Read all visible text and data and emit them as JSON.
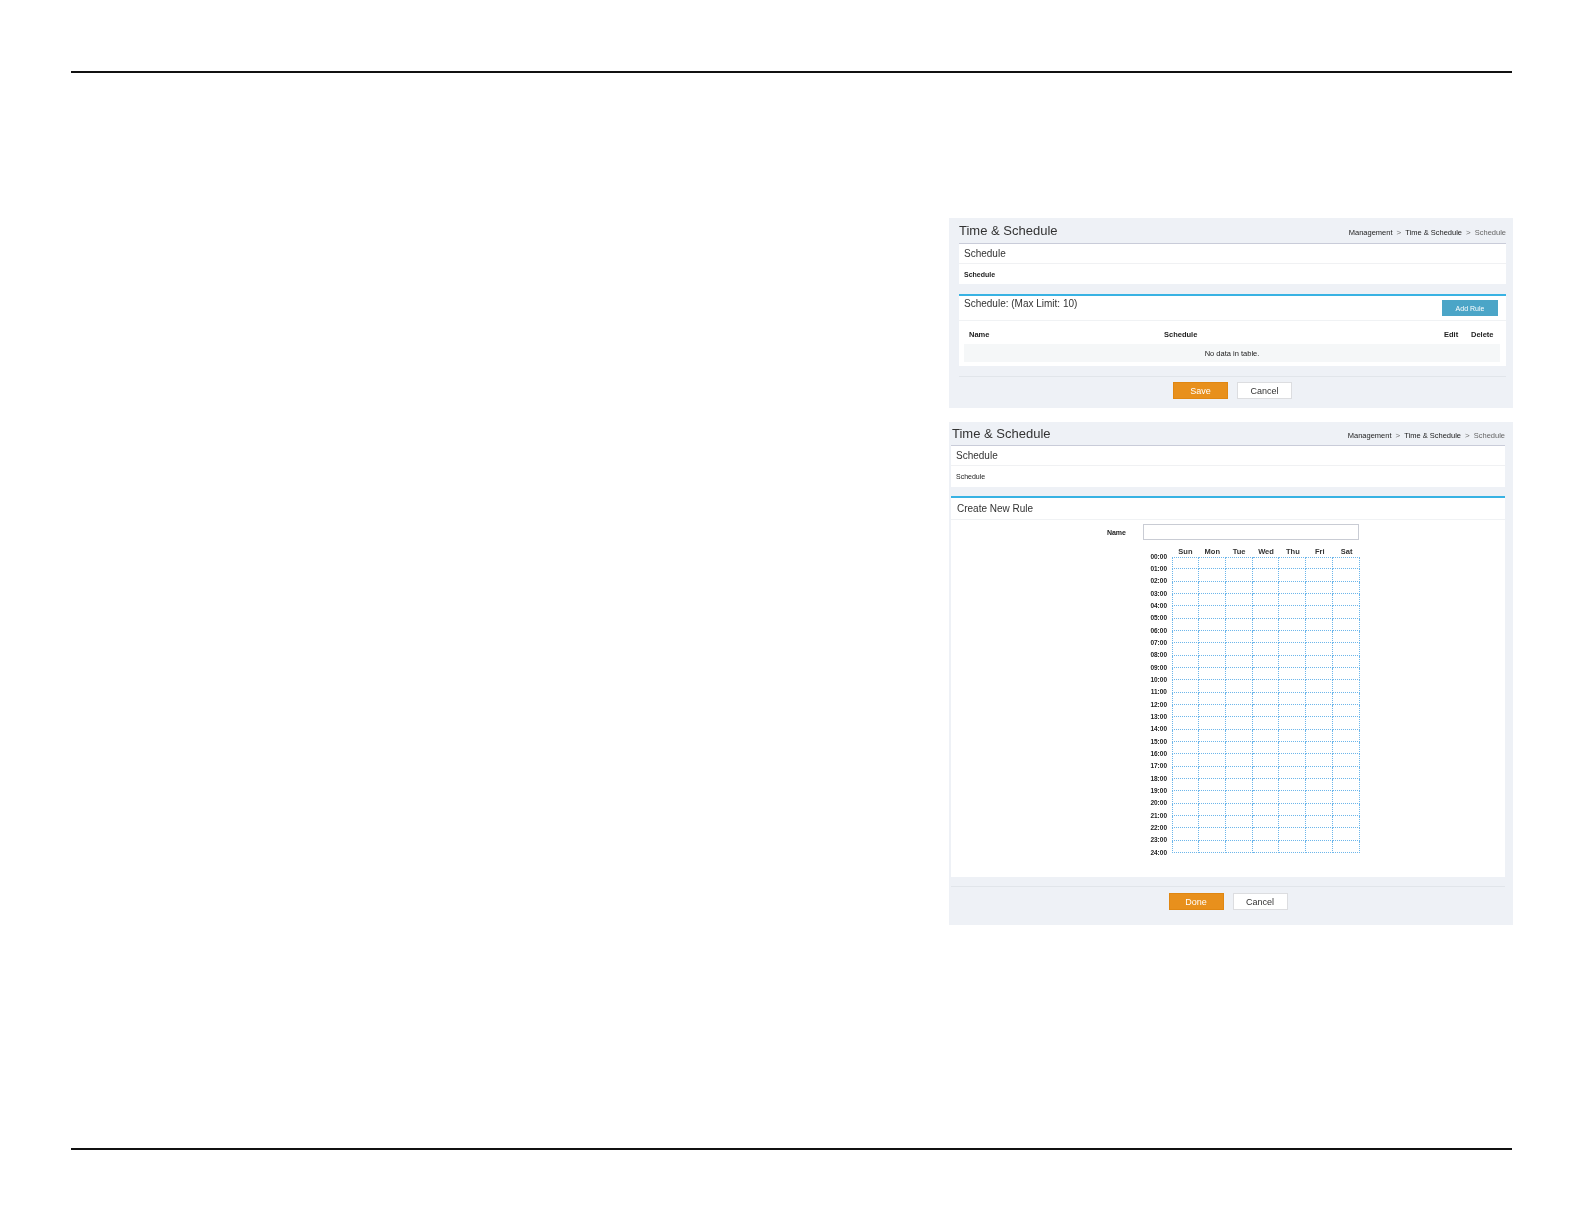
{
  "panels": [
    {
      "kind": "rule_list",
      "title": "Time & Schedule",
      "breadcrumb": [
        {
          "text": "Management",
          "kind": "link"
        },
        {
          "text": ">",
          "kind": "separator"
        },
        {
          "text": "Time & Schedule",
          "kind": "link"
        },
        {
          "text": ">",
          "kind": "separator"
        },
        {
          "text": "Schedule",
          "kind": "current"
        }
      ],
      "section": {
        "heading": "Schedule",
        "label": "Schedule"
      },
      "rules": {
        "heading": "Schedule: (Max Limit: 10)",
        "add_button": "Add Rule",
        "columns": [
          "Name",
          "Schedule",
          "Edit",
          "Delete"
        ],
        "empty_text": "No data in table."
      },
      "buttons": [
        {
          "label": "Save",
          "kind": "primary"
        },
        {
          "label": "Cancel",
          "kind": "secondary"
        }
      ]
    },
    {
      "kind": "rule_form",
      "title": "Time & Schedule",
      "breadcrumb": [
        {
          "text": "Management",
          "kind": "link"
        },
        {
          "text": ">",
          "kind": "separator"
        },
        {
          "text": "Time & Schedule",
          "kind": "link"
        },
        {
          "text": ">",
          "kind": "separator"
        },
        {
          "text": "Schedule",
          "kind": "current"
        }
      ],
      "section": {
        "heading": "Schedule",
        "label": "Schedule"
      },
      "form": {
        "heading": "Create New Rule",
        "name_field": {
          "label": "Name"
        },
        "days": [
          "Sun",
          "Mon",
          "Tue",
          "Wed",
          "Thu",
          "Fri",
          "Sat"
        ],
        "hours": [
          "00:00",
          "01:00",
          "02:00",
          "03:00",
          "04:00",
          "05:00",
          "06:00",
          "07:00",
          "08:00",
          "09:00",
          "10:00",
          "11:00",
          "12:00",
          "13:00",
          "14:00",
          "15:00",
          "16:00",
          "17:00",
          "18:00",
          "19:00",
          "20:00",
          "21:00",
          "22:00",
          "23:00",
          "24:00"
        ]
      },
      "buttons": [
        {
          "label": "Done",
          "kind": "primary"
        },
        {
          "label": "Cancel",
          "kind": "secondary"
        }
      ]
    }
  ]
}
